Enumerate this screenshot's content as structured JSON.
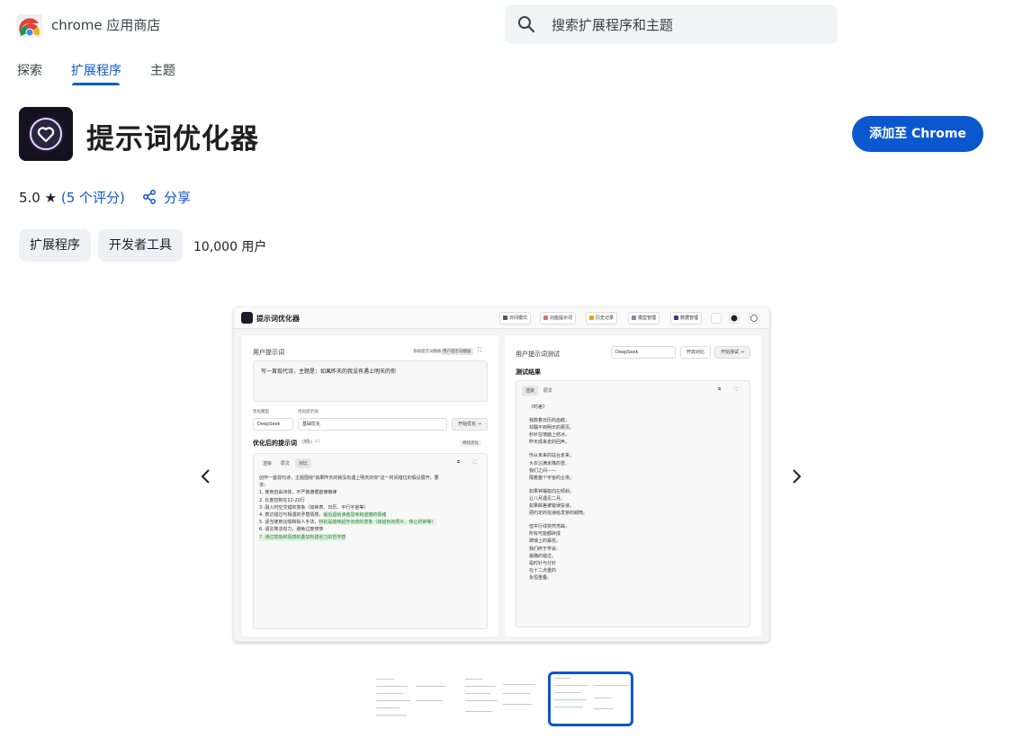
{
  "header": {
    "store_name": "chrome 应用商店",
    "search_placeholder": "搜索扩展程序和主题"
  },
  "nav": {
    "items": [
      {
        "label": "探索",
        "active": false
      },
      {
        "label": "扩展程序",
        "active": true
      },
      {
        "label": "主题",
        "active": false
      }
    ]
  },
  "app": {
    "title": "提示词优化器",
    "add_button": "添加至 Chrome",
    "rating_value": "5.0",
    "rating_star": "★",
    "rating_count": "(5 个评分)",
    "share_label": "分享",
    "chips": [
      "扩展程序",
      "开发者工具"
    ],
    "users": "10,000 用户"
  },
  "screenshot": {
    "app_title": "提示词优化器",
    "toolbar": [
      "日间模式",
      "功能提示词",
      "历史记录",
      "模型管理",
      "数据管理"
    ],
    "left": {
      "section_title": "用户提示词",
      "mini_right_label": "系统提示词模板",
      "mini_button": "用户提示词模板",
      "input_text": "写一首现代诗，主题是：如果昨天的我没有遇上明天的你",
      "model_label": "优化模型",
      "template_label": "优化提示词",
      "model_value": "DeepSeek",
      "template_value": "基础优化",
      "optimize_button": "开始优化 →",
      "result_title": "优化后的提示词",
      "versions": [
        "V1",
        "V2"
      ],
      "continue_button": "继续优化",
      "tabs": [
        "渲染",
        "原文",
        "对比"
      ],
      "lines": [
        "创作一首现代诗，主题围绕\"如果昨天的我没有遇上明天的你\"这一时间错位的假设展开。要",
        "求：",
        "1. 使用自由诗体，不严格遵循韵律格律",
        "2. 长度控制在12-20行",
        "3. 融入时空交错的意象（如钟表、日历、平行宇宙等）",
        "4. 表达错过与相遇的矛盾情感，",
        "5. 适当使用比喻和拟人手法，",
        "6. 语言简洁有力，避免过度修饰",
        "7. 通过意象和情感的叠加构建张力的哲学感"
      ],
      "line4_highlight": "最后留给读者思考和遗憾的情绪",
      "line5_highlight": "特别是能唤起怀旧感的意象（如褪色的照片、停止的钟等）"
    },
    "right": {
      "section_title": "用户提示词测试",
      "model_value": "DeepSeek",
      "compare_button": "开启对比",
      "test_button": "开始测试 →",
      "result_title": "测试结果",
      "tabs": [
        "渲染",
        "原文"
      ],
      "poem": [
        "《时差》",
        "",
        "我数着日历的齿痕，",
        "却翻不到明天的那页。",
        "秒针在墙面上结冰，",
        "昨天成来走的回声。",
        "",
        "你从未来的站台走来，",
        "大衣沾满未降的雪。",
        "我们之间——",
        "隔着整个宇宙的尘埃。",
        "",
        "如果钟摆能向左倾斜，",
        "让八月遇见二月。",
        "如果邮差被错误投递，",
        "把约定的信递给发芽的邮筒。",
        "",
        "但平行线突然弯曲，",
        "所有可能都碎成",
        "玻璃上的霜花。",
        "我们终于学会:",
        "最确的错过，",
        "是时针与分针",
        "在十二点重的",
        "永恒重叠。"
      ]
    }
  }
}
